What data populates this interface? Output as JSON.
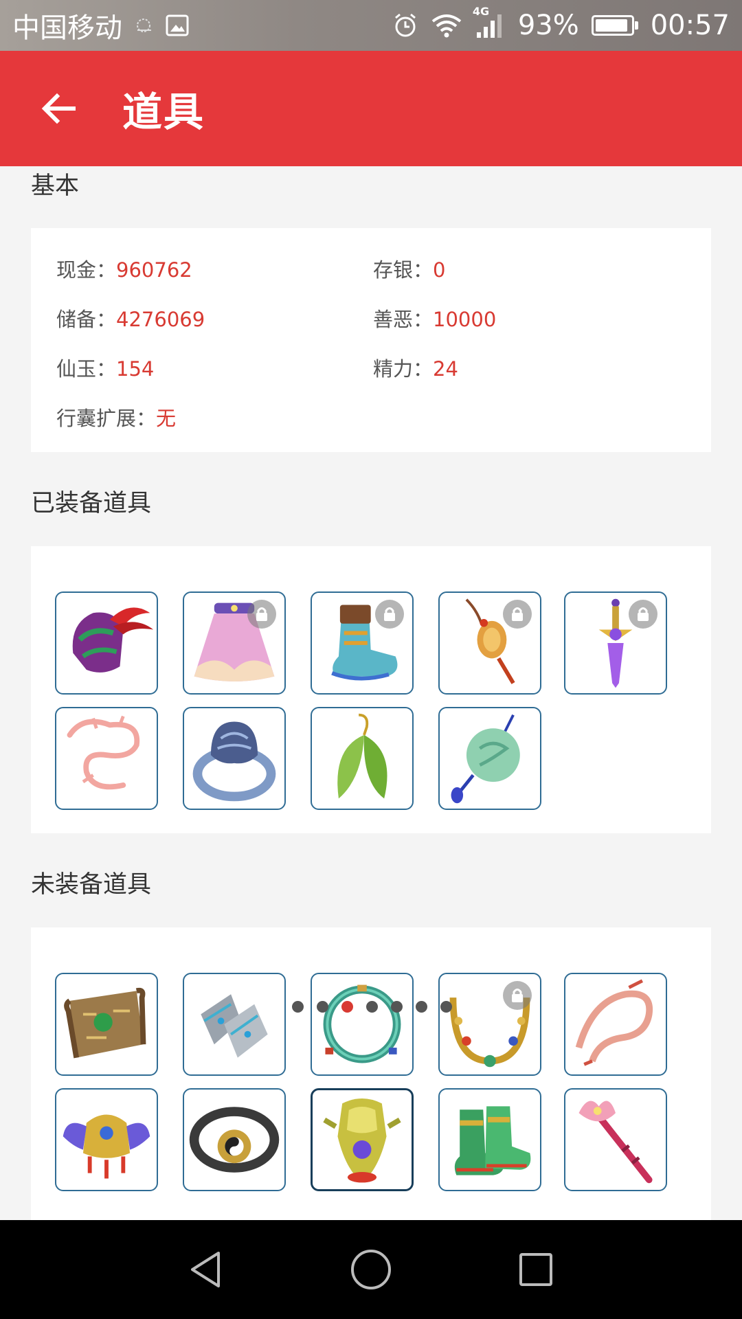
{
  "status_bar": {
    "carrier": "中国移动",
    "network": "4G",
    "battery": "93%",
    "battery_level": 0.93,
    "time": "00:57"
  },
  "app_bar": {
    "title": "道具"
  },
  "basic": {
    "title": "基本",
    "stats": [
      {
        "label": "现金：",
        "value": "960762"
      },
      {
        "label": "存银：",
        "value": "0"
      },
      {
        "label": "储备：",
        "value": "4276069"
      },
      {
        "label": "善恶：",
        "value": "10000"
      },
      {
        "label": "仙玉：",
        "value": "154"
      },
      {
        "label": "精力：",
        "value": "24"
      },
      {
        "label": "行囊扩展：",
        "value": "无"
      }
    ]
  },
  "equipped": {
    "title": "已装备道具",
    "items": [
      {
        "icon": "helmet-icon",
        "locked": false
      },
      {
        "icon": "skirt-armor-icon",
        "locked": true
      },
      {
        "icon": "boots-icon",
        "locked": true
      },
      {
        "icon": "pendant-icon",
        "locked": true
      },
      {
        "icon": "sword-pendant-icon",
        "locked": true
      },
      {
        "icon": "coral-necklace-icon",
        "locked": false
      },
      {
        "icon": "ring-icon",
        "locked": false
      },
      {
        "icon": "leaf-earring-icon",
        "locked": false
      },
      {
        "icon": "jade-pendant-icon",
        "locked": false
      }
    ]
  },
  "unequipped": {
    "title": "未装备道具",
    "items": [
      {
        "icon": "scroll-map-icon",
        "locked": false
      },
      {
        "icon": "bracers-icon",
        "locked": false
      },
      {
        "icon": "jade-bracelet-icon",
        "locked": false
      },
      {
        "icon": "gold-necklace-icon",
        "locked": true
      },
      {
        "icon": "ribbon-icon",
        "locked": false
      },
      {
        "icon": "winged-crown-icon",
        "locked": false
      },
      {
        "icon": "taiji-belt-icon",
        "locked": false
      },
      {
        "icon": "golden-armor-icon",
        "locked": false,
        "selected": true
      },
      {
        "icon": "green-boots-icon",
        "locked": false
      },
      {
        "icon": "lotus-staff-icon",
        "locked": false
      }
    ]
  },
  "pager": {
    "count": 7,
    "active": 2
  },
  "nav_bar": {
    "buttons": [
      "back-nav-icon",
      "home-nav-icon",
      "recents-nav-icon"
    ]
  },
  "colors": {
    "accent": "#e5383b",
    "value": "#d83a32",
    "item_border": "#2f6c94"
  }
}
